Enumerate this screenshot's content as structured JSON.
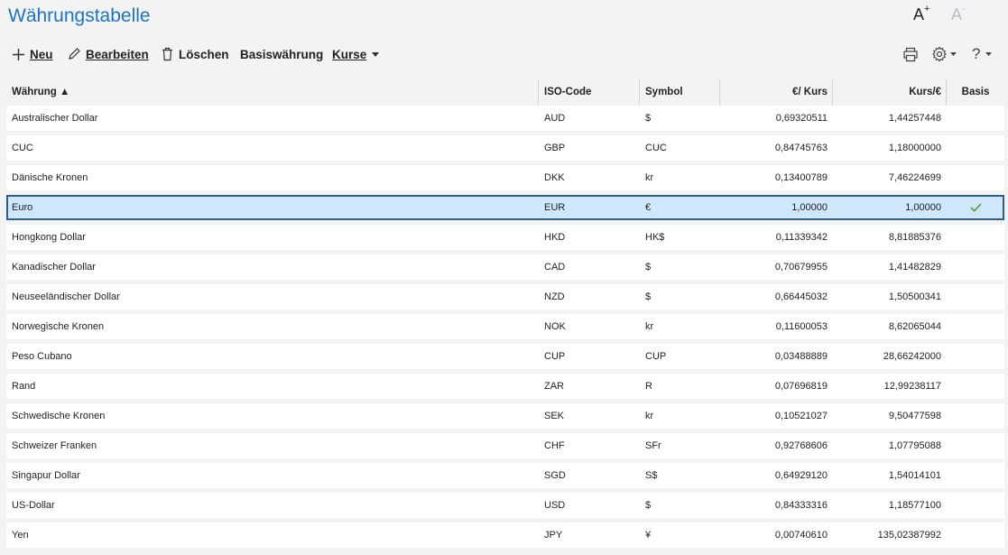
{
  "window": {
    "title": "Währungstabelle",
    "font_larger_label": "A",
    "font_larger_sup": "+",
    "font_smaller_label": "A",
    "font_smaller_sup": "-"
  },
  "toolbar": {
    "new_label": "Neu",
    "edit_label": "Bearbeiten",
    "delete_label": "Löschen",
    "base_currency_label": "Basiswährung",
    "rates_label": "Kurse",
    "help_label": "?"
  },
  "table": {
    "columns": {
      "name": "Währung",
      "iso": "ISO-Code",
      "symbol": "Symbol",
      "eur_per": "€/ Kurs",
      "kurs_per_eur": "Kurs/€",
      "basis": "Basis"
    },
    "sort_indicator": "▲",
    "rows": [
      {
        "name": "Australischer Dollar",
        "iso": "AUD",
        "symbol": "$",
        "eur": "0,69320511",
        "kurs": "1,44257448",
        "basis": false
      },
      {
        "name": "CUC",
        "iso": "GBP",
        "symbol": "CUC",
        "eur": "0,84745763",
        "kurs": "1,18000000",
        "basis": false
      },
      {
        "name": "Dänische Kronen",
        "iso": "DKK",
        "symbol": "kr",
        "eur": "0,13400789",
        "kurs": "7,46224699",
        "basis": false
      },
      {
        "name": "Euro",
        "iso": "EUR",
        "symbol": "€",
        "eur": "1,00000",
        "kurs": "1,00000",
        "basis": true
      },
      {
        "name": "Hongkong Dollar",
        "iso": "HKD",
        "symbol": "HK$",
        "eur": "0,11339342",
        "kurs": "8,81885376",
        "basis": false
      },
      {
        "name": "Kanadischer Dollar",
        "iso": "CAD",
        "symbol": "$",
        "eur": "0,70679955",
        "kurs": "1,41482829",
        "basis": false
      },
      {
        "name": "Neuseeländischer Dollar",
        "iso": "NZD",
        "symbol": "$",
        "eur": "0,66445032",
        "kurs": "1,50500341",
        "basis": false
      },
      {
        "name": "Norwegische Kronen",
        "iso": "NOK",
        "symbol": "kr",
        "eur": "0,11600053",
        "kurs": "8,62065044",
        "basis": false
      },
      {
        "name": "Peso Cubano",
        "iso": "CUP",
        "symbol": "CUP",
        "eur": "0,03488889",
        "kurs": "28,66242000",
        "basis": false
      },
      {
        "name": "Rand",
        "iso": "ZAR",
        "symbol": "R",
        "eur": "0,07696819",
        "kurs": "12,99238117",
        "basis": false
      },
      {
        "name": "Schwedische Kronen",
        "iso": "SEK",
        "symbol": "kr",
        "eur": "0,10521027",
        "kurs": "9,50477598",
        "basis": false
      },
      {
        "name": "Schweizer Franken",
        "iso": "CHF",
        "symbol": "SFr",
        "eur": "0,92768606",
        "kurs": "1,07795088",
        "basis": false
      },
      {
        "name": "Singapur Dollar",
        "iso": "SGD",
        "symbol": "S$",
        "eur": "0,64929120",
        "kurs": "1,54014101",
        "basis": false
      },
      {
        "name": "US-Dollar",
        "iso": "USD",
        "symbol": "$",
        "eur": "0,84333316",
        "kurs": "1,18577100",
        "basis": false
      },
      {
        "name": "Yen",
        "iso": "JPY",
        "symbol": "¥",
        "eur": "0,00740610",
        "kurs": "135,02387992",
        "basis": false
      }
    ],
    "selected_row_index": 3
  },
  "icons": {
    "new": "plus-icon",
    "edit": "pencil-icon",
    "delete": "trash-icon",
    "print": "printer-icon",
    "settings": "gear-icon",
    "basis_mark": "check-icon"
  },
  "colors": {
    "title": "#1d73c9",
    "selection_bg": "#cfe7fb",
    "selection_border": "#2f5e86",
    "check": "#5a9a2e"
  }
}
